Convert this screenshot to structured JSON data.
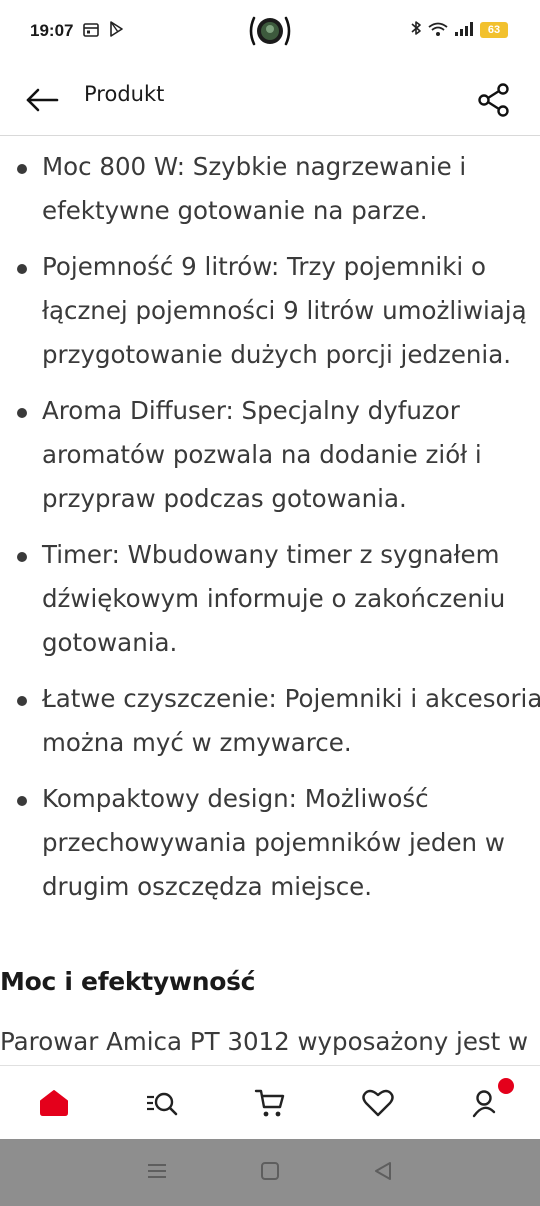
{
  "status_bar": {
    "time": "19:07",
    "battery": "63"
  },
  "header": {
    "title": "Produkt"
  },
  "bullets": [
    "Moc 800 W: Szybkie nagrzewanie i efektywne gotowanie na parze.",
    "Pojemność 9 litrów: Trzy pojemniki o łącznej pojemności 9 litrów umożliwiają przygotowanie dużych porcji jedzenia.",
    "Aroma Diffuser: Specjalny dyfuzor aromatów pozwala na dodanie ziół i przypraw podczas gotowania.",
    "Timer: Wbudowany timer z sygnałem dźwiękowym informuje o zakończeniu gotowania.",
    "Łatwe czyszczenie: Pojemniki i akcesoria można myć w zmywarce.",
    "Kompaktowy design: Możliwość przechowywania pojemników jeden w drugim oszczędza miejsce."
  ],
  "section": {
    "heading": "Moc i efektywność",
    "paragraph": "Parowar Amica PT 3012 wyposażony jest w"
  },
  "colors": {
    "accent": "#e4001b",
    "text": "#3a3a3a",
    "battery": "#f2c12e"
  },
  "nav": [
    {
      "icon": "home-icon"
    },
    {
      "icon": "search-list-icon"
    },
    {
      "icon": "cart-icon"
    },
    {
      "icon": "heart-icon"
    },
    {
      "icon": "user-icon"
    }
  ]
}
